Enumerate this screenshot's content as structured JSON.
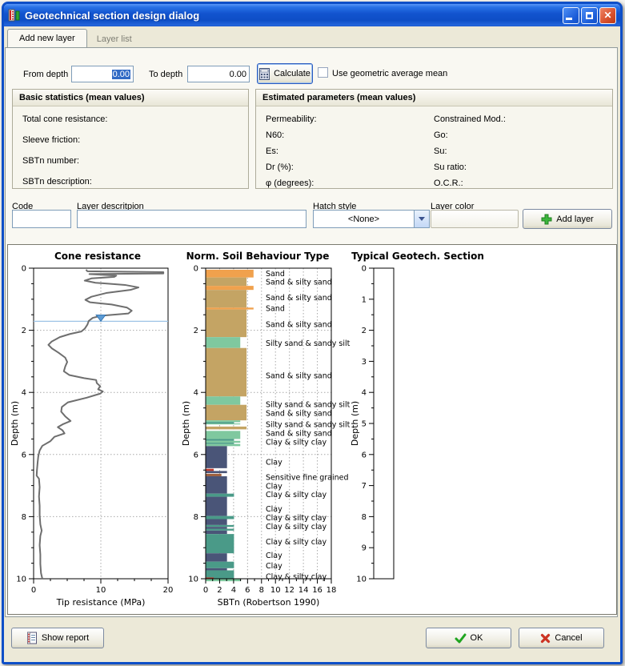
{
  "window": {
    "title": "Geotechnical section design dialog"
  },
  "tabs": [
    {
      "label": "Add new layer",
      "active": true
    },
    {
      "label": "Layer list",
      "active": false
    }
  ],
  "form": {
    "from_depth_label": "From depth",
    "from_depth_value": "0.00",
    "to_depth_label": "To depth",
    "to_depth_value": "0.00",
    "calculate_label": "Calculate",
    "geometric_mean_label": "Use geometric average mean",
    "code_label": "Code",
    "code_value": "",
    "layer_description_label": "Layer descritpion",
    "layer_description_value": "",
    "hatch_style_label": "Hatch style",
    "hatch_style_value": "<None>",
    "layer_color_label": "Layer color",
    "add_layer_label": "Add layer"
  },
  "basic_statistics": {
    "title": "Basic statistics (mean values)",
    "rows": [
      "Total cone resistance:",
      "Sleeve friction:",
      "SBTn number:",
      "SBTn description:"
    ]
  },
  "estimated_parameters": {
    "title": "Estimated parameters (mean values)",
    "left": [
      "Permeability:",
      "N60:",
      "Es:",
      "Dr (%):",
      "φ (degrees):"
    ],
    "right": [
      "Constrained Mod.:",
      "Go:",
      "Su:",
      "Su ratio:",
      "O.C.R.:"
    ]
  },
  "footer": {
    "show_report_label": "Show report",
    "ok_label": "OK",
    "cancel_label": "Cancel"
  },
  "chart_data": [
    {
      "type": "line",
      "title": "Cone resistance",
      "xlabel": "Tip resistance (MPa)",
      "ylabel": "Depth (m)",
      "xlim": [
        0,
        20
      ],
      "ylim": [
        0,
        10
      ],
      "y_inverted": true,
      "xticks": [
        0,
        10,
        20
      ],
      "yticks": [
        0,
        2,
        4,
        6,
        8,
        10
      ],
      "grid_x": [
        10
      ],
      "grid_y": [
        2,
        4,
        6,
        8
      ],
      "line_color": "#6E6E6E",
      "water_table_depth": 1.71,
      "water_line_color": "#9DC3E6",
      "water_marker_color": "#5B9BD5",
      "points": [
        [
          7.8,
          0.05
        ],
        [
          8.0,
          0.1
        ],
        [
          19.3,
          0.13
        ],
        [
          19.3,
          0.17
        ],
        [
          8.3,
          0.19
        ],
        [
          12.3,
          0.24
        ],
        [
          12.0,
          0.28
        ],
        [
          8.6,
          0.33
        ],
        [
          7.6,
          0.4
        ],
        [
          9.2,
          0.47
        ],
        [
          13.6,
          0.54
        ],
        [
          15.6,
          0.62
        ],
        [
          14.4,
          0.7
        ],
        [
          10.8,
          0.8
        ],
        [
          8.6,
          0.92
        ],
        [
          7.7,
          1.02
        ],
        [
          8.4,
          1.1
        ],
        [
          11.6,
          1.17
        ],
        [
          13.9,
          1.27
        ],
        [
          14.6,
          1.37
        ],
        [
          14.1,
          1.46
        ],
        [
          10.1,
          1.53
        ],
        [
          8.8,
          1.6
        ],
        [
          8.2,
          1.7
        ],
        [
          8.0,
          1.82
        ],
        [
          7.6,
          1.95
        ],
        [
          7.1,
          2.04
        ],
        [
          5.4,
          2.12
        ],
        [
          3.9,
          2.22
        ],
        [
          2.7,
          2.36
        ],
        [
          2.2,
          2.47
        ],
        [
          2.7,
          2.58
        ],
        [
          3.7,
          2.72
        ],
        [
          4.7,
          2.88
        ],
        [
          5.0,
          3.02
        ],
        [
          4.7,
          3.17
        ],
        [
          4.5,
          3.32
        ],
        [
          5.3,
          3.44
        ],
        [
          7.5,
          3.54
        ],
        [
          9.3,
          3.6
        ],
        [
          9.4,
          3.7
        ],
        [
          9.9,
          3.8
        ],
        [
          9.6,
          3.9
        ],
        [
          10.3,
          3.97
        ],
        [
          9.9,
          4.04
        ],
        [
          7.9,
          4.17
        ],
        [
          5.1,
          4.32
        ],
        [
          4.2,
          4.47
        ],
        [
          4.1,
          4.62
        ],
        [
          4.7,
          4.77
        ],
        [
          5.5,
          4.92
        ],
        [
          4.4,
          5.02
        ],
        [
          3.6,
          5.12
        ],
        [
          4.3,
          5.22
        ],
        [
          4.6,
          5.32
        ],
        [
          3.1,
          5.43
        ],
        [
          2.5,
          5.57
        ],
        [
          1.3,
          5.72
        ],
        [
          0.9,
          5.87
        ],
        [
          0.7,
          6.05
        ],
        [
          0.6,
          6.25
        ],
        [
          0.5,
          6.5
        ],
        [
          0.45,
          6.68
        ],
        [
          0.8,
          6.78
        ],
        [
          0.9,
          7.05
        ],
        [
          0.8,
          7.35
        ],
        [
          0.9,
          7.65
        ],
        [
          0.9,
          7.95
        ],
        [
          1.0,
          8.25
        ],
        [
          1.2,
          8.45
        ],
        [
          1.0,
          8.62
        ],
        [
          0.9,
          8.92
        ],
        [
          1.0,
          9.22
        ],
        [
          1.0,
          9.52
        ],
        [
          1.1,
          9.82
        ],
        [
          1.3,
          10.0
        ]
      ]
    },
    {
      "type": "bar",
      "title": "Norm. Soil Behaviour Type",
      "xlabel": "SBTn (Robertson 1990)",
      "ylabel": "Depth (m)",
      "xlim": [
        0,
        18
      ],
      "ylim": [
        0,
        10
      ],
      "y_inverted": true,
      "xticks": [
        0,
        2,
        4,
        6,
        8,
        10,
        12,
        14,
        16,
        18
      ],
      "yticks": [
        0,
        2,
        4,
        6,
        8,
        10
      ],
      "grid_x": [
        2,
        4,
        6,
        8,
        10,
        12,
        14,
        16
      ],
      "grid_y": [
        2,
        4,
        6,
        8
      ],
      "soil_types": {
        "sand": {
          "color": "#F0A14D",
          "width": 6.8
        },
        "sand_silty_sand": {
          "color": "#C4A464",
          "width": 5.8
        },
        "silty_sand_sandy_silt": {
          "color": "#7FC89F",
          "width": 4.9
        },
        "clay_silty_clay": {
          "color": "#4A9A88",
          "width": 4.0
        },
        "clay": {
          "color": "#4A5578",
          "width": 3.0
        },
        "sensitive_fine_grained": {
          "color": "#C0392B",
          "width": 1.1
        },
        "brown": {
          "color": "#9E5F3C",
          "width": 2.2
        }
      },
      "segments": [
        [
          0.05,
          0.3,
          "sand"
        ],
        [
          0.3,
          0.57,
          "sand_silty_sand"
        ],
        [
          0.57,
          0.7,
          "sand"
        ],
        [
          0.7,
          1.27,
          "sand_silty_sand"
        ],
        [
          1.27,
          1.33,
          "sand"
        ],
        [
          1.33,
          2.22,
          "sand_silty_sand"
        ],
        [
          2.22,
          2.57,
          "silty_sand_sandy_silt"
        ],
        [
          2.57,
          4.13,
          "sand_silty_sand"
        ],
        [
          4.13,
          4.4,
          "silty_sand_sandy_silt"
        ],
        [
          4.4,
          4.9,
          "sand_silty_sand"
        ],
        [
          4.9,
          4.96,
          "silty_sand_sandy_silt"
        ],
        [
          4.96,
          5.0,
          "clay_silty_clay"
        ],
        [
          5.0,
          5.03,
          "silty_sand_sandy_silt"
        ],
        [
          5.1,
          5.19,
          "sand_silty_sand"
        ],
        [
          5.24,
          5.5,
          "silty_sand_sandy_silt"
        ],
        [
          5.5,
          5.56,
          "clay_silty_clay"
        ],
        [
          5.56,
          5.62,
          "silty_sand_sandy_silt"
        ],
        [
          5.62,
          5.66,
          "clay_silty_clay"
        ],
        [
          5.66,
          5.73,
          "silty_sand_sandy_silt"
        ],
        [
          5.73,
          6.44,
          "clay"
        ],
        [
          6.46,
          6.53,
          "sensitive_fine_grained"
        ],
        [
          6.53,
          6.6,
          "clay"
        ],
        [
          6.62,
          6.7,
          "brown"
        ],
        [
          6.7,
          7.26,
          "clay"
        ],
        [
          7.26,
          7.36,
          "clay_silty_clay"
        ],
        [
          7.36,
          7.98,
          "clay"
        ],
        [
          7.98,
          8.08,
          "clay_silty_clay"
        ],
        [
          8.08,
          8.27,
          "clay"
        ],
        [
          8.27,
          8.33,
          "clay_silty_clay"
        ],
        [
          8.33,
          8.39,
          "clay"
        ],
        [
          8.39,
          8.45,
          "clay_silty_clay"
        ],
        [
          8.45,
          8.56,
          "clay"
        ],
        [
          8.56,
          9.18,
          "clay_silty_clay"
        ],
        [
          9.18,
          9.45,
          "clay"
        ],
        [
          9.45,
          9.66,
          "clay_silty_clay"
        ],
        [
          9.66,
          9.73,
          "clay"
        ],
        [
          9.73,
          10.0,
          "clay_silty_clay"
        ],
        [
          9.96,
          10.04,
          "sensitive_fine_grained"
        ],
        [
          10.0,
          10.08,
          "silty_sand_sandy_silt",
          5.0
        ]
      ],
      "labels": [
        [
          0.18,
          "Sand"
        ],
        [
          0.45,
          "Sand & silty sand"
        ],
        [
          0.95,
          "Sand & silty sand"
        ],
        [
          1.3,
          "Sand"
        ],
        [
          1.82,
          "Sand & silty sand"
        ],
        [
          2.42,
          "Silty sand & sandy silt"
        ],
        [
          3.47,
          "Sand & silty sand"
        ],
        [
          4.4,
          "Silty sand & sandy silt"
        ],
        [
          4.68,
          "Sand & silty sand"
        ],
        [
          5.04,
          "Silty sand & sandy silt"
        ],
        [
          5.32,
          "Sand & silty sand"
        ],
        [
          5.6,
          "Clay & silty clay"
        ],
        [
          6.25,
          "Clay"
        ],
        [
          6.74,
          "Sensitive fine grained"
        ],
        [
          7.02,
          "Clay"
        ],
        [
          7.3,
          "Clay & silty clay"
        ],
        [
          7.76,
          "Clay"
        ],
        [
          8.04,
          "Clay & silty clay"
        ],
        [
          8.33,
          "Clay & silty clay"
        ],
        [
          8.81,
          "Clay & silty clay"
        ],
        [
          9.25,
          "Clay"
        ],
        [
          9.59,
          "Clay"
        ],
        [
          9.94,
          "Clay & silty clay"
        ]
      ]
    },
    {
      "type": "table",
      "title": "Typical Geotech. Section",
      "ylabel": "Depth (m)",
      "ylim": [
        0,
        10
      ],
      "yticks": [
        0,
        1,
        2,
        3,
        4,
        5,
        6,
        7,
        8,
        9,
        10
      ],
      "column_empty": true
    }
  ]
}
